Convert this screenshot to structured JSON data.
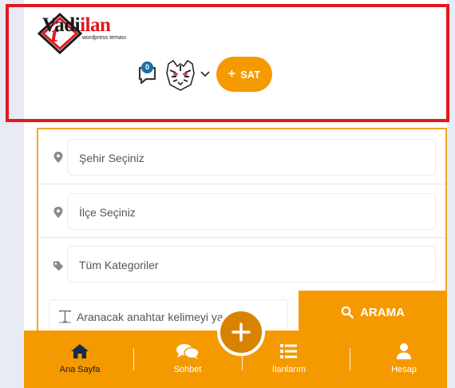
{
  "header": {
    "logo_brand_dark": "Vadi",
    "logo_brand_red": "ilan",
    "logo_tagline": "wordpress teması",
    "message_count": "0",
    "sat_label": "SAT"
  },
  "search": {
    "city_placeholder": "Şehir Seçiniz",
    "district_placeholder": "İlçe Seçiniz",
    "category_placeholder": "Tüm Kategoriler",
    "keyword_placeholder": "Aranacak anahtar kelimeyi ya",
    "search_button_label": "ARAMA"
  },
  "bottom_nav": {
    "items": [
      {
        "label": "Ana Sayfa",
        "icon": "home-icon"
      },
      {
        "label": "Sohbet",
        "icon": "chat-icon"
      },
      {
        "label": "İlanlarım",
        "icon": "list-icon"
      },
      {
        "label": "Hesap",
        "icon": "user-icon"
      }
    ]
  },
  "colors": {
    "accent": "#f49a00",
    "highlight": "#e3171f",
    "badge": "#1d6fa5"
  }
}
